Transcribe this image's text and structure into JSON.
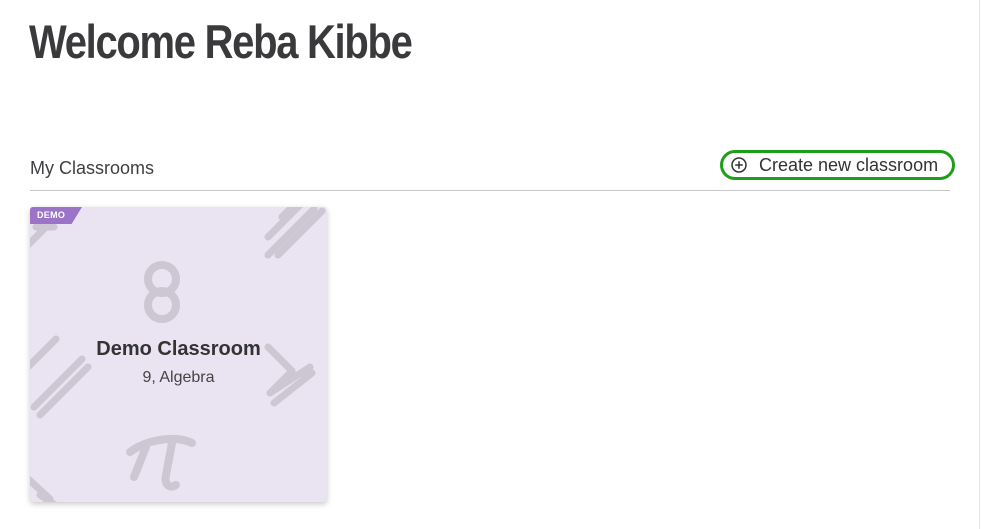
{
  "page": {
    "welcome": "Welcome Reba Kibbe"
  },
  "classrooms_section": {
    "title": "My Classrooms",
    "create_button": {
      "label": "Create new classroom",
      "icon": "plus-circle-icon",
      "border_color": "#1f9e1a"
    }
  },
  "classrooms": [
    {
      "badge": "DEMO",
      "name": "Demo Classroom",
      "details": "9, Algebra",
      "card_color": "#e9e3f2",
      "badge_color": "#9b74c7"
    }
  ]
}
